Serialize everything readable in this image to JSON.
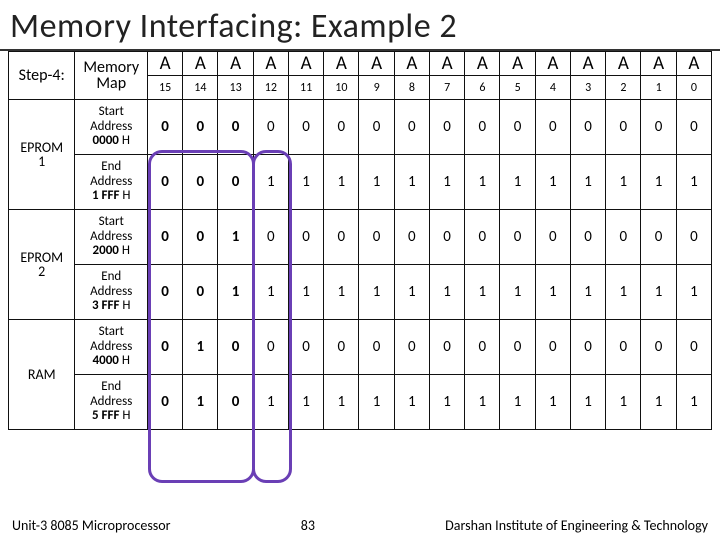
{
  "title": "Memory Interfacing: Example 2",
  "step_label_top": "Step-4:",
  "step_label_bot": "",
  "map_top": "Memory",
  "map_bot": "Map",
  "bit_header": "A",
  "bit_indices": [
    "15",
    "14",
    "13",
    "12",
    "11",
    "10",
    "9",
    "8",
    "7",
    "6",
    "5",
    "4",
    "3",
    "2",
    "1",
    "0"
  ],
  "blocks": [
    {
      "name": "EPROM 1",
      "rows": [
        {
          "label": "Start Address",
          "addr": "0000",
          "suffix": " H",
          "bits": [
            "0",
            "0",
            "0",
            "0",
            "0",
            "0",
            "0",
            "0",
            "0",
            "0",
            "0",
            "0",
            "0",
            "0",
            "0",
            "0"
          ]
        },
        {
          "label": "End Address",
          "addr": "1 FFF",
          "suffix": " H",
          "bits": [
            "0",
            "0",
            "0",
            "1",
            "1",
            "1",
            "1",
            "1",
            "1",
            "1",
            "1",
            "1",
            "1",
            "1",
            "1",
            "1"
          ]
        }
      ]
    },
    {
      "name": "EPROM 2",
      "rows": [
        {
          "label": "Start Address",
          "addr": "2000",
          "suffix": " H",
          "bits": [
            "0",
            "0",
            "1",
            "0",
            "0",
            "0",
            "0",
            "0",
            "0",
            "0",
            "0",
            "0",
            "0",
            "0",
            "0",
            "0"
          ]
        },
        {
          "label": "End Address",
          "addr": "3 FFF",
          "suffix": " H",
          "bits": [
            "0",
            "0",
            "1",
            "1",
            "1",
            "1",
            "1",
            "1",
            "1",
            "1",
            "1",
            "1",
            "1",
            "1",
            "1",
            "1"
          ]
        }
      ]
    },
    {
      "name": "RAM",
      "rows": [
        {
          "label": "Start Address",
          "addr": "4000",
          "suffix": " H",
          "bits": [
            "0",
            "1",
            "0",
            "0",
            "0",
            "0",
            "0",
            "0",
            "0",
            "0",
            "0",
            "0",
            "0",
            "0",
            "0",
            "0"
          ]
        },
        {
          "label": "End Address",
          "addr": "5 FFF",
          "suffix": " H",
          "bits": [
            "0",
            "1",
            "0",
            "1",
            "1",
            "1",
            "1",
            "1",
            "1",
            "1",
            "1",
            "1",
            "1",
            "1",
            "1",
            "1"
          ]
        }
      ]
    }
  ],
  "footer": {
    "left": "Unit-3 8085 Microprocessor",
    "page": "83",
    "right": "Darshan Institute of Engineering & Technology"
  }
}
